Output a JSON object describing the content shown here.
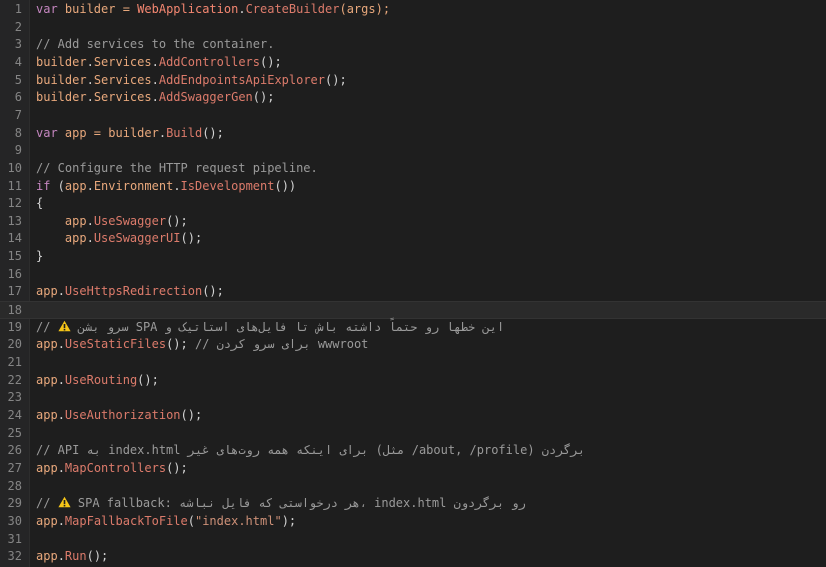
{
  "lines": [
    {
      "num": "1",
      "tokens": [
        {
          "t": "var",
          "c": "kw"
        },
        {
          "t": " builder = ",
          "c": "var"
        },
        {
          "t": "WebApplication",
          "c": "cls"
        },
        {
          "t": ".",
          "c": "pun"
        },
        {
          "t": "CreateBuilder",
          "c": "mtd"
        },
        {
          "t": "(args);",
          "c": "var"
        }
      ]
    },
    {
      "num": "2",
      "tokens": []
    },
    {
      "num": "3",
      "tokens": [
        {
          "t": "// Add services to the container.",
          "c": "cmt"
        }
      ]
    },
    {
      "num": "4",
      "tokens": [
        {
          "t": "builder",
          "c": "var"
        },
        {
          "t": ".",
          "c": "pun"
        },
        {
          "t": "Services",
          "c": "var"
        },
        {
          "t": ".",
          "c": "pun"
        },
        {
          "t": "AddControllers",
          "c": "mtd"
        },
        {
          "t": "();",
          "c": "pun"
        }
      ]
    },
    {
      "num": "5",
      "tokens": [
        {
          "t": "builder",
          "c": "var"
        },
        {
          "t": ".",
          "c": "pun"
        },
        {
          "t": "Services",
          "c": "var"
        },
        {
          "t": ".",
          "c": "pun"
        },
        {
          "t": "AddEndpointsApiExplorer",
          "c": "mtd"
        },
        {
          "t": "();",
          "c": "pun"
        }
      ]
    },
    {
      "num": "6",
      "tokens": [
        {
          "t": "builder",
          "c": "var"
        },
        {
          "t": ".",
          "c": "pun"
        },
        {
          "t": "Services",
          "c": "var"
        },
        {
          "t": ".",
          "c": "pun"
        },
        {
          "t": "AddSwaggerGen",
          "c": "mtd"
        },
        {
          "t": "();",
          "c": "pun"
        }
      ]
    },
    {
      "num": "7",
      "tokens": []
    },
    {
      "num": "8",
      "tokens": [
        {
          "t": "var",
          "c": "kw"
        },
        {
          "t": " app = ",
          "c": "var"
        },
        {
          "t": "builder",
          "c": "var"
        },
        {
          "t": ".",
          "c": "pun"
        },
        {
          "t": "Build",
          "c": "mtd"
        },
        {
          "t": "();",
          "c": "pun"
        }
      ]
    },
    {
      "num": "9",
      "tokens": []
    },
    {
      "num": "10",
      "tokens": [
        {
          "t": "// Configure the HTTP request pipeline.",
          "c": "cmt"
        }
      ]
    },
    {
      "num": "11",
      "tokens": [
        {
          "t": "if",
          "c": "kw"
        },
        {
          "t": " (",
          "c": "pun"
        },
        {
          "t": "app",
          "c": "var"
        },
        {
          "t": ".",
          "c": "pun"
        },
        {
          "t": "Environment",
          "c": "var"
        },
        {
          "t": ".",
          "c": "pun"
        },
        {
          "t": "IsDevelopment",
          "c": "mtd"
        },
        {
          "t": "())",
          "c": "pun"
        }
      ]
    },
    {
      "num": "12",
      "tokens": [
        {
          "t": "{",
          "c": "pun"
        }
      ]
    },
    {
      "num": "13",
      "tokens": [
        {
          "t": "    app",
          "c": "var"
        },
        {
          "t": ".",
          "c": "pun"
        },
        {
          "t": "UseSwagger",
          "c": "mtd"
        },
        {
          "t": "();",
          "c": "pun"
        }
      ]
    },
    {
      "num": "14",
      "tokens": [
        {
          "t": "    app",
          "c": "var"
        },
        {
          "t": ".",
          "c": "pun"
        },
        {
          "t": "UseSwaggerUI",
          "c": "mtd"
        },
        {
          "t": "();",
          "c": "pun"
        }
      ]
    },
    {
      "num": "15",
      "tokens": [
        {
          "t": "}",
          "c": "pun"
        }
      ]
    },
    {
      "num": "16",
      "tokens": []
    },
    {
      "num": "17",
      "tokens": [
        {
          "t": "app",
          "c": "var"
        },
        {
          "t": ".",
          "c": "pun"
        },
        {
          "t": "UseHttpsRedirection",
          "c": "mtd"
        },
        {
          "t": "();",
          "c": "pun"
        }
      ]
    },
    {
      "num": "18",
      "tokens": [],
      "active": true
    },
    {
      "num": "19",
      "tokens": [
        {
          "t": "// ",
          "c": "cmt"
        },
        {
          "t": "warning-icon",
          "c": "icon"
        },
        {
          "t": " سرو بشن SPA این خطها رو حتماً داشته باش تا فایل‌های استاتیک و",
          "c": "cmt"
        }
      ]
    },
    {
      "num": "20",
      "tokens": [
        {
          "t": "app",
          "c": "var"
        },
        {
          "t": ".",
          "c": "pun"
        },
        {
          "t": "UseStaticFiles",
          "c": "mtd"
        },
        {
          "t": "(); ",
          "c": "pun"
        },
        {
          "t": "// برای سرو کردن wwwroot",
          "c": "cmt"
        }
      ]
    },
    {
      "num": "21",
      "tokens": []
    },
    {
      "num": "22",
      "tokens": [
        {
          "t": "app",
          "c": "var"
        },
        {
          "t": ".",
          "c": "pun"
        },
        {
          "t": "UseRouting",
          "c": "mtd"
        },
        {
          "t": "();",
          "c": "pun"
        }
      ]
    },
    {
      "num": "23",
      "tokens": []
    },
    {
      "num": "24",
      "tokens": [
        {
          "t": "app",
          "c": "var"
        },
        {
          "t": ".",
          "c": "pun"
        },
        {
          "t": "UseAuthorization",
          "c": "mtd"
        },
        {
          "t": "();",
          "c": "pun"
        }
      ]
    },
    {
      "num": "25",
      "tokens": []
    },
    {
      "num": "26",
      "tokens": [
        {
          "t": "// API به index.html برای اینکه همه روت‌های غیر (مثل /about, /profile) برگردن",
          "c": "cmt"
        }
      ]
    },
    {
      "num": "27",
      "tokens": [
        {
          "t": "app",
          "c": "var"
        },
        {
          "t": ".",
          "c": "pun"
        },
        {
          "t": "MapControllers",
          "c": "mtd"
        },
        {
          "t": "();",
          "c": "pun"
        }
      ]
    },
    {
      "num": "28",
      "tokens": []
    },
    {
      "num": "29",
      "tokens": [
        {
          "t": "// ",
          "c": "cmt"
        },
        {
          "t": "warning-icon",
          "c": "icon"
        },
        {
          "t": " SPA fallback: هر درخواستی که فایل نباشه، index.html رو برگردون",
          "c": "cmt"
        }
      ]
    },
    {
      "num": "30",
      "tokens": [
        {
          "t": "app",
          "c": "var"
        },
        {
          "t": ".",
          "c": "pun"
        },
        {
          "t": "MapFallbackToFile",
          "c": "mtd"
        },
        {
          "t": "(",
          "c": "pun"
        },
        {
          "t": "\"index.html\"",
          "c": "str"
        },
        {
          "t": ");",
          "c": "pun"
        }
      ]
    },
    {
      "num": "31",
      "tokens": []
    },
    {
      "num": "32",
      "tokens": [
        {
          "t": "app",
          "c": "var"
        },
        {
          "t": ".",
          "c": "pun"
        },
        {
          "t": "Run",
          "c": "mtd"
        },
        {
          "t": "();",
          "c": "pun"
        }
      ]
    }
  ],
  "colors": {
    "background": "#1e1e1e",
    "gutter": "#252526",
    "keyword": "#c586c0",
    "method": "#dc7b6b",
    "comment": "#9a9a9a",
    "string": "#ce9178",
    "warning": "#f5c518"
  }
}
